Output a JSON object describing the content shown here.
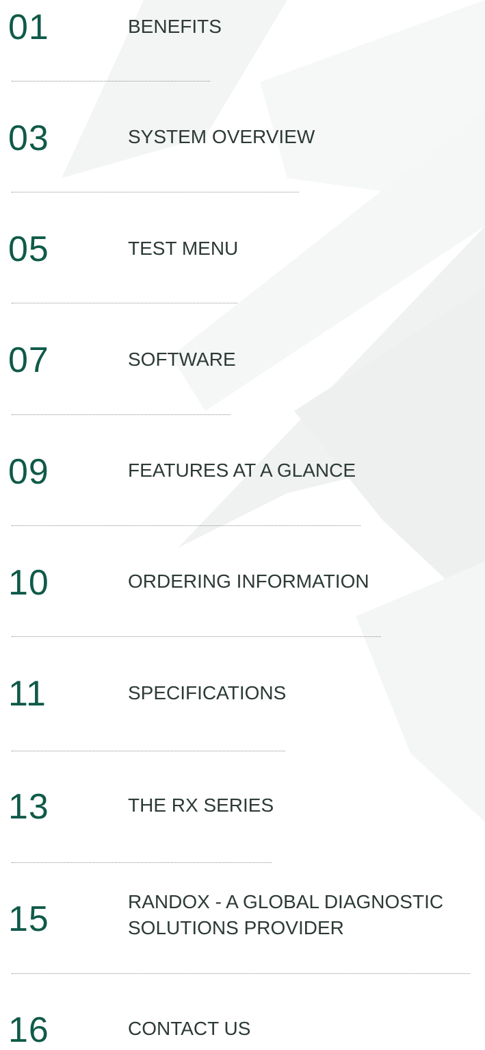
{
  "toc": {
    "items": [
      {
        "number": "01",
        "title": "BENEFITS"
      },
      {
        "number": "03",
        "title": "SYSTEM OVERVIEW"
      },
      {
        "number": "05",
        "title": "TEST MENU"
      },
      {
        "number": "07",
        "title": "SOFTWARE"
      },
      {
        "number": "09",
        "title": "FEATURES AT A GLANCE"
      },
      {
        "number": "10",
        "title": "ORDERING INFORMATION"
      },
      {
        "number": "11",
        "title": "SPECIFICATIONS"
      },
      {
        "number": "13",
        "title": "THE RX SERIES"
      },
      {
        "number": "15",
        "title_line1": "RANDOX - A GLOBAL DIAGNOSTIC",
        "title_line2": "SOLUTIONS PROVIDER"
      },
      {
        "number": "16",
        "title": "CONTACT US"
      }
    ]
  },
  "colors": {
    "accent": "#0f5a48",
    "text": "#2c3a35",
    "divider": "#8c8f8e"
  }
}
